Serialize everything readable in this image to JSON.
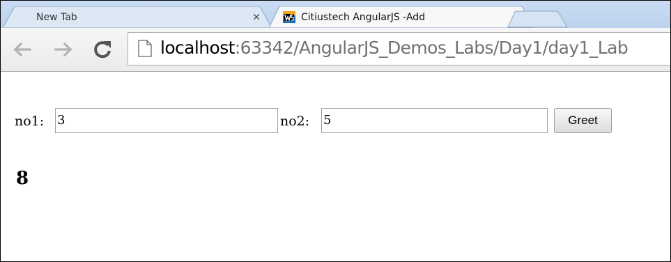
{
  "browser": {
    "tabs": [
      {
        "title": "New Tab",
        "close": "×",
        "active": false
      },
      {
        "title": "Citiustech AngularJS -Add",
        "close": "×",
        "active": true,
        "favicon": "webstorm-ws-icon"
      }
    ],
    "nav": {
      "back": "back-arrow-icon",
      "forward": "forward-arrow-icon",
      "reload": "reload-icon"
    },
    "url": {
      "host": "localhost",
      "rest": ":63342/AngularJS_Demos_Labs/Day1/day1_Lab"
    }
  },
  "page": {
    "no1_label": "no1:",
    "no1_value": "3",
    "no2_label": "no2:",
    "no2_value": "5",
    "greet_label": "Greet",
    "result": "8"
  },
  "colors": {
    "tab_strip": "#c3d8f0",
    "active_tab": "#f7f7f7",
    "url_host": "#000000",
    "url_rest": "#727272"
  }
}
